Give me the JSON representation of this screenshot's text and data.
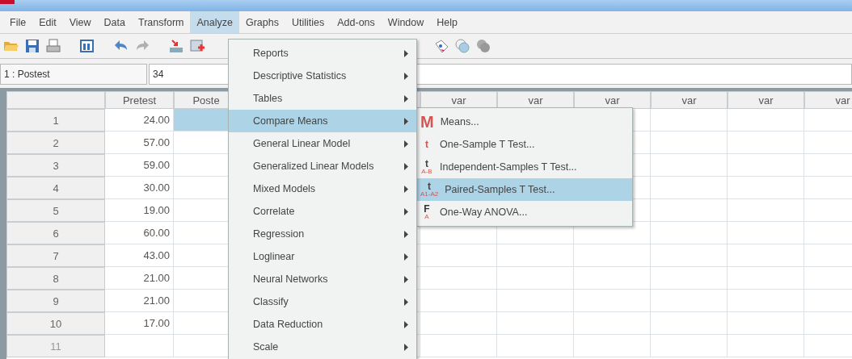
{
  "menubar": [
    {
      "label": "File",
      "selected": false
    },
    {
      "label": "Edit",
      "selected": false
    },
    {
      "label": "View",
      "selected": false
    },
    {
      "label": "Data",
      "selected": false
    },
    {
      "label": "Transform",
      "selected": false
    },
    {
      "label": "Analyze",
      "selected": true
    },
    {
      "label": "Graphs",
      "selected": false
    },
    {
      "label": "Utilities",
      "selected": false
    },
    {
      "label": "Add-ons",
      "selected": false
    },
    {
      "label": "Window",
      "selected": false
    },
    {
      "label": "Help",
      "selected": false
    }
  ],
  "cell_editor": {
    "cell": "1 : Postest",
    "value": "34"
  },
  "grid": {
    "columns": [
      "Pretest",
      "Poste",
      "var",
      "var",
      "var",
      "var",
      "var",
      "var"
    ],
    "rows": [
      {
        "number": "1",
        "pretest": "24.00",
        "postest_selected": true
      },
      {
        "number": "2",
        "pretest": "57.00",
        "postest_selected": false
      },
      {
        "number": "3",
        "pretest": "59.00",
        "postest_selected": false
      },
      {
        "number": "4",
        "pretest": "30.00",
        "postest_selected": false
      },
      {
        "number": "5",
        "pretest": "19.00",
        "postest_selected": false
      },
      {
        "number": "6",
        "pretest": "60.00",
        "postest_selected": false
      },
      {
        "number": "7",
        "pretest": "43.00",
        "postest_selected": false
      },
      {
        "number": "8",
        "pretest": "21.00",
        "postest_selected": false
      },
      {
        "number": "9",
        "pretest": "21.00",
        "postest_selected": false
      },
      {
        "number": "10",
        "pretest": "17.00",
        "postest_selected": false
      },
      {
        "number": "11",
        "pretest": "",
        "postest_selected": false
      }
    ]
  },
  "analyze_menu": {
    "items": [
      {
        "label": "Reports",
        "selected": false
      },
      {
        "label": "Descriptive Statistics",
        "selected": false
      },
      {
        "label": "Tables",
        "selected": false
      },
      {
        "label": "Compare Means",
        "selected": true
      },
      {
        "label": "General Linear Model",
        "selected": false
      },
      {
        "label": "Generalized Linear Models",
        "selected": false
      },
      {
        "label": "Mixed Models",
        "selected": false
      },
      {
        "label": "Correlate",
        "selected": false
      },
      {
        "label": "Regression",
        "selected": false
      },
      {
        "label": "Loglinear",
        "selected": false
      },
      {
        "label": "Neural Networks",
        "selected": false
      },
      {
        "label": "Classify",
        "selected": false
      },
      {
        "label": "Data Reduction",
        "selected": false
      },
      {
        "label": "Scale",
        "selected": false
      }
    ]
  },
  "compare_means_menu": {
    "items": [
      {
        "label": "Means...",
        "selected": false,
        "icon": {
          "glyph": "M",
          "kind": "big",
          "color": "#d9534f"
        }
      },
      {
        "label": "One-Sample T Test...",
        "selected": false,
        "icon": {
          "glyph": "t",
          "kind": "small",
          "color": "#d9534f"
        }
      },
      {
        "label": "Independent-Samples T Test...",
        "selected": false,
        "icon": {
          "glyph": "t",
          "sub": "A-B",
          "kind": "small",
          "color": "#444444"
        }
      },
      {
        "label": "Paired-Samples T Test...",
        "selected": true,
        "icon": {
          "glyph": "t",
          "sub": "A1-A2",
          "kind": "small",
          "color": "#444444"
        }
      },
      {
        "label": "One-Way ANOVA...",
        "selected": false,
        "icon": {
          "glyph": "F",
          "sub": "A",
          "kind": "small",
          "color": "#333333"
        }
      }
    ]
  }
}
